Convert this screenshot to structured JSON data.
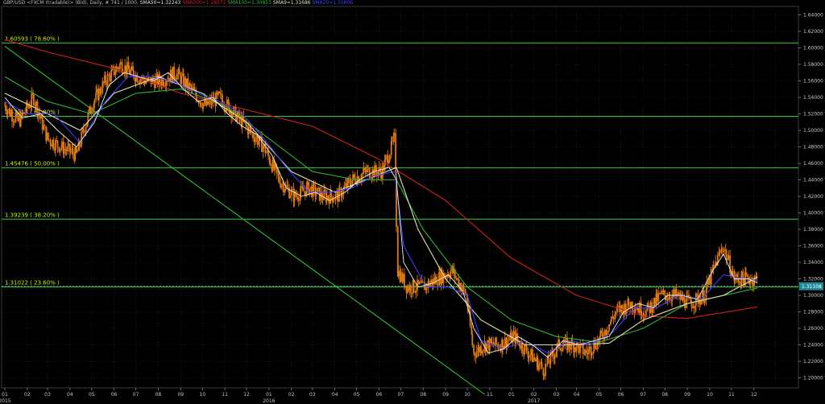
{
  "header": {
    "symbol_info": "GBP/USD <FXCM (tradable)> (Bid), Daily, # 741 / 1000,",
    "sma50": "SMA50=1.32243",
    "sma200": "SMA200=1.28572",
    "sma100": "SMA100=1.30853",
    "sma9": "SMA9=1.31686",
    "sma20": "SMA20=1.31806"
  },
  "colors": {
    "background": "#000000",
    "grid": "#2a2a2a",
    "fib_lines": "#2fcf3a",
    "fib_text": "#c8f000",
    "sma200": "#d21e1e",
    "sma100": "#2fb32f",
    "sma50": "#e8e0b0",
    "sma20": "#3a3aff",
    "sma9": "#f0f0f0",
    "candles": "#e07a10",
    "current_price_bg": "#1f8a9a",
    "current_price_line": "#1f9fb0"
  },
  "chart_data": {
    "type": "line",
    "instrument": "GBP/USD",
    "timeframe": "Daily",
    "ylim": [
      1.18,
      1.65
    ],
    "y_ticks": [
      "1.64000",
      "1.62000",
      "1.60000",
      "1.58000",
      "1.56000",
      "1.54000",
      "1.52000",
      "1.50000",
      "1.48000",
      "1.46000",
      "1.44000",
      "1.42000",
      "1.40000",
      "1.38000",
      "1.36000",
      "1.34000",
      "1.32000",
      "1.30000",
      "1.28000",
      "1.26000",
      "1.24000",
      "1.22000",
      "1.20000"
    ],
    "x_ticks": [
      "01",
      "02",
      "03",
      "04",
      "05",
      "06",
      "07",
      "08",
      "09",
      "10",
      "11",
      "12",
      "01",
      "02",
      "03",
      "04",
      "05",
      "06",
      "07",
      "08",
      "09",
      "10",
      "11",
      "01",
      "02",
      "03",
      "04",
      "05",
      "06",
      "07",
      "08",
      "09",
      "10",
      "11",
      "12"
    ],
    "year_labels": [
      "2015",
      "2016",
      "2017"
    ],
    "fib_levels": [
      {
        "label": "1.60593 ( 78.60% )",
        "value": 1.60593
      },
      {
        "label": "1.51713 ( 61.80% )",
        "value": 1.51713
      },
      {
        "label": "1.45476 ( 50.00% )",
        "value": 1.45476
      },
      {
        "label": "1.39239 ( 38.20% )",
        "value": 1.39239
      },
      {
        "label": "1.31022 ( 23.60% )",
        "value": 1.31022
      }
    ],
    "current_price": "1.31108",
    "trendline": {
      "from": {
        "date": "2015-01-01",
        "value": 1.602
      },
      "to": {
        "date": "2016-10-25",
        "value": 1.18
      }
    },
    "price_series": {
      "name": "GBP/USD",
      "dates": [
        "2015-01-01",
        "2015-01-20",
        "2015-02-10",
        "2015-03-01",
        "2015-03-20",
        "2015-04-10",
        "2015-05-01",
        "2015-05-20",
        "2015-06-10",
        "2015-06-25",
        "2015-07-15",
        "2015-08-05",
        "2015-08-25",
        "2015-09-15",
        "2015-10-05",
        "2015-10-25",
        "2015-11-15",
        "2015-12-05",
        "2015-12-25",
        "2016-01-15",
        "2016-02-05",
        "2016-02-25",
        "2016-03-15",
        "2016-04-05",
        "2016-04-25",
        "2016-05-15",
        "2016-06-05",
        "2016-06-23",
        "2016-06-27",
        "2016-07-10",
        "2016-08-01",
        "2016-08-20",
        "2016-09-10",
        "2016-09-30",
        "2016-10-10",
        "2016-10-25",
        "2016-11-15",
        "2016-12-05",
        "2016-12-25",
        "2017-01-15",
        "2017-02-05",
        "2017-02-25",
        "2017-03-15",
        "2017-04-05",
        "2017-04-25",
        "2017-05-15",
        "2017-06-05",
        "2017-06-25",
        "2017-07-15",
        "2017-08-05",
        "2017-08-25",
        "2017-09-10",
        "2017-09-20",
        "2017-10-05",
        "2017-10-25",
        "2017-11-06"
      ],
      "values": [
        1.53,
        1.51,
        1.54,
        1.49,
        1.48,
        1.47,
        1.53,
        1.56,
        1.58,
        1.57,
        1.56,
        1.56,
        1.57,
        1.55,
        1.53,
        1.54,
        1.52,
        1.5,
        1.48,
        1.44,
        1.42,
        1.43,
        1.42,
        1.42,
        1.44,
        1.45,
        1.45,
        1.49,
        1.33,
        1.31,
        1.31,
        1.32,
        1.33,
        1.3,
        1.23,
        1.24,
        1.24,
        1.25,
        1.23,
        1.21,
        1.24,
        1.24,
        1.23,
        1.25,
        1.28,
        1.29,
        1.28,
        1.3,
        1.3,
        1.29,
        1.3,
        1.34,
        1.36,
        1.32,
        1.32,
        1.32
      ]
    },
    "sma_series": [
      {
        "name": "SMA200",
        "color": "#d21e1e",
        "dates": [
          "2015-01-01",
          "2015-03-01",
          "2015-06-01",
          "2015-09-01",
          "2015-12-01",
          "2016-03-01",
          "2016-06-01",
          "2016-09-01",
          "2016-12-01",
          "2017-03-01",
          "2017-06-01",
          "2017-08-01",
          "2017-11-06"
        ],
        "values": [
          1.61,
          1.595,
          1.575,
          1.545,
          1.525,
          1.505,
          1.465,
          1.415,
          1.345,
          1.3,
          1.275,
          1.272,
          1.286
        ]
      },
      {
        "name": "SMA100",
        "color": "#2fb32f",
        "dates": [
          "2015-01-01",
          "2015-03-01",
          "2015-05-01",
          "2015-07-01",
          "2015-09-01",
          "2015-11-01",
          "2016-01-01",
          "2016-03-01",
          "2016-05-01",
          "2016-06-25",
          "2016-08-01",
          "2016-10-01",
          "2016-12-01",
          "2017-02-01",
          "2017-04-01",
          "2017-06-01",
          "2017-08-01",
          "2017-11-06"
        ],
        "values": [
          1.565,
          1.535,
          1.52,
          1.545,
          1.55,
          1.53,
          1.49,
          1.45,
          1.44,
          1.44,
          1.38,
          1.31,
          1.27,
          1.25,
          1.243,
          1.26,
          1.29,
          1.309
        ]
      },
      {
        "name": "SMA50",
        "color": "#e8e0b0",
        "dates": [
          "2015-01-01",
          "2015-03-01",
          "2015-04-15",
          "2015-06-01",
          "2015-08-01",
          "2015-10-01",
          "2015-12-01",
          "2016-02-01",
          "2016-04-01",
          "2016-06-25",
          "2016-07-25",
          "2016-09-01",
          "2016-10-20",
          "2016-12-20",
          "2017-02-20",
          "2017-04-15",
          "2017-06-01",
          "2017-08-01",
          "2017-09-20",
          "2017-11-06"
        ],
        "values": [
          1.545,
          1.52,
          1.5,
          1.545,
          1.565,
          1.545,
          1.51,
          1.45,
          1.425,
          1.455,
          1.38,
          1.32,
          1.27,
          1.24,
          1.24,
          1.242,
          1.27,
          1.29,
          1.3,
          1.322
        ]
      },
      {
        "name": "SMA20",
        "color": "#3a3aff",
        "dates": [
          "2015-01-01",
          "2015-02-01",
          "2015-03-10",
          "2015-04-15",
          "2015-05-20",
          "2015-06-20",
          "2015-07-20",
          "2015-08-20",
          "2015-09-25",
          "2015-10-25",
          "2015-11-25",
          "2015-12-25",
          "2016-01-25",
          "2016-02-25",
          "2016-03-25",
          "2016-04-25",
          "2016-05-25",
          "2016-06-23",
          "2016-07-05",
          "2016-08-05",
          "2016-09-05",
          "2016-10-01",
          "2016-10-20",
          "2016-11-20",
          "2016-12-20",
          "2017-01-20",
          "2017-02-20",
          "2017-03-20",
          "2017-04-20",
          "2017-05-20",
          "2017-06-20",
          "2017-07-20",
          "2017-08-20",
          "2017-09-20",
          "2017-10-20",
          "2017-11-06"
        ],
        "values": [
          1.535,
          1.52,
          1.52,
          1.485,
          1.535,
          1.565,
          1.565,
          1.56,
          1.545,
          1.535,
          1.52,
          1.49,
          1.455,
          1.425,
          1.425,
          1.43,
          1.445,
          1.45,
          1.36,
          1.31,
          1.31,
          1.3,
          1.245,
          1.235,
          1.245,
          1.23,
          1.245,
          1.24,
          1.255,
          1.285,
          1.285,
          1.3,
          1.295,
          1.325,
          1.32,
          1.318
        ]
      },
      {
        "name": "SMA9",
        "color": "#f0f0f0",
        "dates": [
          "2015-01-01",
          "2015-01-25",
          "2015-02-20",
          "2015-03-15",
          "2015-04-10",
          "2015-05-05",
          "2015-05-25",
          "2015-06-15",
          "2015-07-05",
          "2015-07-25",
          "2015-08-15",
          "2015-09-05",
          "2015-09-25",
          "2015-10-15",
          "2015-11-05",
          "2015-11-25",
          "2015-12-15",
          "2016-01-05",
          "2016-01-25",
          "2016-02-15",
          "2016-03-05",
          "2016-03-25",
          "2016-04-15",
          "2016-05-05",
          "2016-05-25",
          "2016-06-15",
          "2016-06-25",
          "2016-07-05",
          "2016-07-25",
          "2016-08-15",
          "2016-09-05",
          "2016-09-25",
          "2016-10-10",
          "2016-10-30",
          "2016-11-20",
          "2016-12-10",
          "2016-12-30",
          "2017-01-20",
          "2017-02-10",
          "2017-03-05",
          "2017-03-25",
          "2017-04-15",
          "2017-05-05",
          "2017-05-25",
          "2017-06-15",
          "2017-07-05",
          "2017-07-25",
          "2017-08-15",
          "2017-09-05",
          "2017-09-20",
          "2017-10-05",
          "2017-10-25",
          "2017-11-06"
        ],
        "values": [
          1.54,
          1.515,
          1.52,
          1.5,
          1.48,
          1.51,
          1.555,
          1.57,
          1.565,
          1.56,
          1.57,
          1.55,
          1.535,
          1.54,
          1.52,
          1.505,
          1.495,
          1.47,
          1.43,
          1.42,
          1.425,
          1.415,
          1.425,
          1.44,
          1.45,
          1.455,
          1.44,
          1.34,
          1.31,
          1.315,
          1.325,
          1.305,
          1.26,
          1.23,
          1.235,
          1.25,
          1.24,
          1.225,
          1.245,
          1.24,
          1.245,
          1.25,
          1.28,
          1.29,
          1.285,
          1.3,
          1.3,
          1.295,
          1.33,
          1.35,
          1.32,
          1.32,
          1.315
        ]
      }
    ]
  }
}
